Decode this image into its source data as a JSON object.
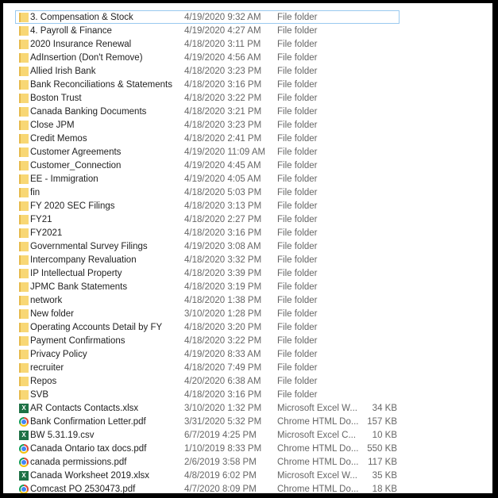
{
  "files": [
    {
      "name": "3. Compensation & Stock",
      "date": "4/19/2020 9:32 AM",
      "type": "File folder",
      "size": "",
      "icon": "folder",
      "selected": true
    },
    {
      "name": "4. Payroll & Finance",
      "date": "4/19/2020 4:27 AM",
      "type": "File folder",
      "size": "",
      "icon": "folder"
    },
    {
      "name": "2020 Insurance Renewal",
      "date": "4/18/2020 3:11 PM",
      "type": "File folder",
      "size": "",
      "icon": "folder"
    },
    {
      "name": "AdInsertion (Don't Remove)",
      "date": "4/19/2020 4:56 AM",
      "type": "File folder",
      "size": "",
      "icon": "folder"
    },
    {
      "name": "Allied Irish Bank",
      "date": "4/18/2020 3:23 PM",
      "type": "File folder",
      "size": "",
      "icon": "folder"
    },
    {
      "name": "Bank Reconciliations & Statements",
      "date": "4/18/2020 3:16 PM",
      "type": "File folder",
      "size": "",
      "icon": "folder"
    },
    {
      "name": "Boston Trust",
      "date": "4/18/2020 3:22 PM",
      "type": "File folder",
      "size": "",
      "icon": "folder"
    },
    {
      "name": "Canada Banking Documents",
      "date": "4/18/2020 3:21 PM",
      "type": "File folder",
      "size": "",
      "icon": "folder"
    },
    {
      "name": "Close JPM",
      "date": "4/18/2020 3:23 PM",
      "type": "File folder",
      "size": "",
      "icon": "folder"
    },
    {
      "name": "Credit Memos",
      "date": "4/18/2020 2:41 PM",
      "type": "File folder",
      "size": "",
      "icon": "folder"
    },
    {
      "name": "Customer Agreements",
      "date": "4/19/2020 11:09 AM",
      "type": "File folder",
      "size": "",
      "icon": "folder"
    },
    {
      "name": "Customer_Connection",
      "date": "4/19/2020 4:45 AM",
      "type": "File folder",
      "size": "",
      "icon": "folder"
    },
    {
      "name": "EE - Immigration",
      "date": "4/19/2020 4:05 AM",
      "type": "File folder",
      "size": "",
      "icon": "folder"
    },
    {
      "name": "fin",
      "date": "4/18/2020 5:03 PM",
      "type": "File folder",
      "size": "",
      "icon": "folder"
    },
    {
      "name": "FY 2020 SEC Filings",
      "date": "4/18/2020 3:13 PM",
      "type": "File folder",
      "size": "",
      "icon": "folder"
    },
    {
      "name": "FY21",
      "date": "4/18/2020 2:27 PM",
      "type": "File folder",
      "size": "",
      "icon": "folder"
    },
    {
      "name": "FY2021",
      "date": "4/18/2020 3:16 PM",
      "type": "File folder",
      "size": "",
      "icon": "folder"
    },
    {
      "name": "Governmental Survey Filings",
      "date": "4/19/2020 3:08 AM",
      "type": "File folder",
      "size": "",
      "icon": "folder"
    },
    {
      "name": "Intercompany Revaluation",
      "date": "4/18/2020 3:32 PM",
      "type": "File folder",
      "size": "",
      "icon": "folder"
    },
    {
      "name": "IP Intellectual Property",
      "date": "4/18/2020 3:39 PM",
      "type": "File folder",
      "size": "",
      "icon": "folder"
    },
    {
      "name": "JPMC Bank Statements",
      "date": "4/18/2020 3:19 PM",
      "type": "File folder",
      "size": "",
      "icon": "folder"
    },
    {
      "name": "network",
      "date": "4/18/2020 1:38 PM",
      "type": "File folder",
      "size": "",
      "icon": "folder"
    },
    {
      "name": "New folder",
      "date": "3/10/2020 1:28 PM",
      "type": "File folder",
      "size": "",
      "icon": "folder"
    },
    {
      "name": "Operating Accounts Detail by FY",
      "date": "4/18/2020 3:20 PM",
      "type": "File folder",
      "size": "",
      "icon": "folder"
    },
    {
      "name": "Payment Confirmations",
      "date": "4/18/2020 3:22 PM",
      "type": "File folder",
      "size": "",
      "icon": "folder"
    },
    {
      "name": "Privacy Policy",
      "date": "4/19/2020 8:33 AM",
      "type": "File folder",
      "size": "",
      "icon": "folder"
    },
    {
      "name": "recruiter",
      "date": "4/18/2020 7:49 PM",
      "type": "File folder",
      "size": "",
      "icon": "folder"
    },
    {
      "name": "Repos",
      "date": "4/20/2020 6:38 AM",
      "type": "File folder",
      "size": "",
      "icon": "folder"
    },
    {
      "name": "SVB",
      "date": "4/18/2020 3:16 PM",
      "type": "File folder",
      "size": "",
      "icon": "folder"
    },
    {
      "name": "AR Contacts Contacts.xlsx",
      "date": "3/10/2020 1:32 PM",
      "type": "Microsoft Excel W...",
      "size": "34 KB",
      "icon": "excel"
    },
    {
      "name": "Bank Confirmation Letter.pdf",
      "date": "3/31/2020 5:32 PM",
      "type": "Chrome HTML Do...",
      "size": "157 KB",
      "icon": "chrome"
    },
    {
      "name": "BW 5.31.19.csv",
      "date": "6/7/2019 4:25 PM",
      "type": "Microsoft Excel C...",
      "size": "10 KB",
      "icon": "excel"
    },
    {
      "name": "Canada Ontario tax docs.pdf",
      "date": "1/10/2019 8:33 PM",
      "type": "Chrome HTML Do...",
      "size": "550 KB",
      "icon": "chrome"
    },
    {
      "name": "canada permissions.pdf",
      "date": "2/6/2019 3:58 PM",
      "type": "Chrome HTML Do...",
      "size": "117 KB",
      "icon": "chrome"
    },
    {
      "name": "Canada Worksheet 2019.xlsx",
      "date": "4/8/2019 6:02 PM",
      "type": "Microsoft Excel W...",
      "size": "35 KB",
      "icon": "excel"
    },
    {
      "name": "Comcast PO 2530473.pdf",
      "date": "4/7/2020 8:09 PM",
      "type": "Chrome HTML Do...",
      "size": "18 KB",
      "icon": "chrome"
    }
  ]
}
